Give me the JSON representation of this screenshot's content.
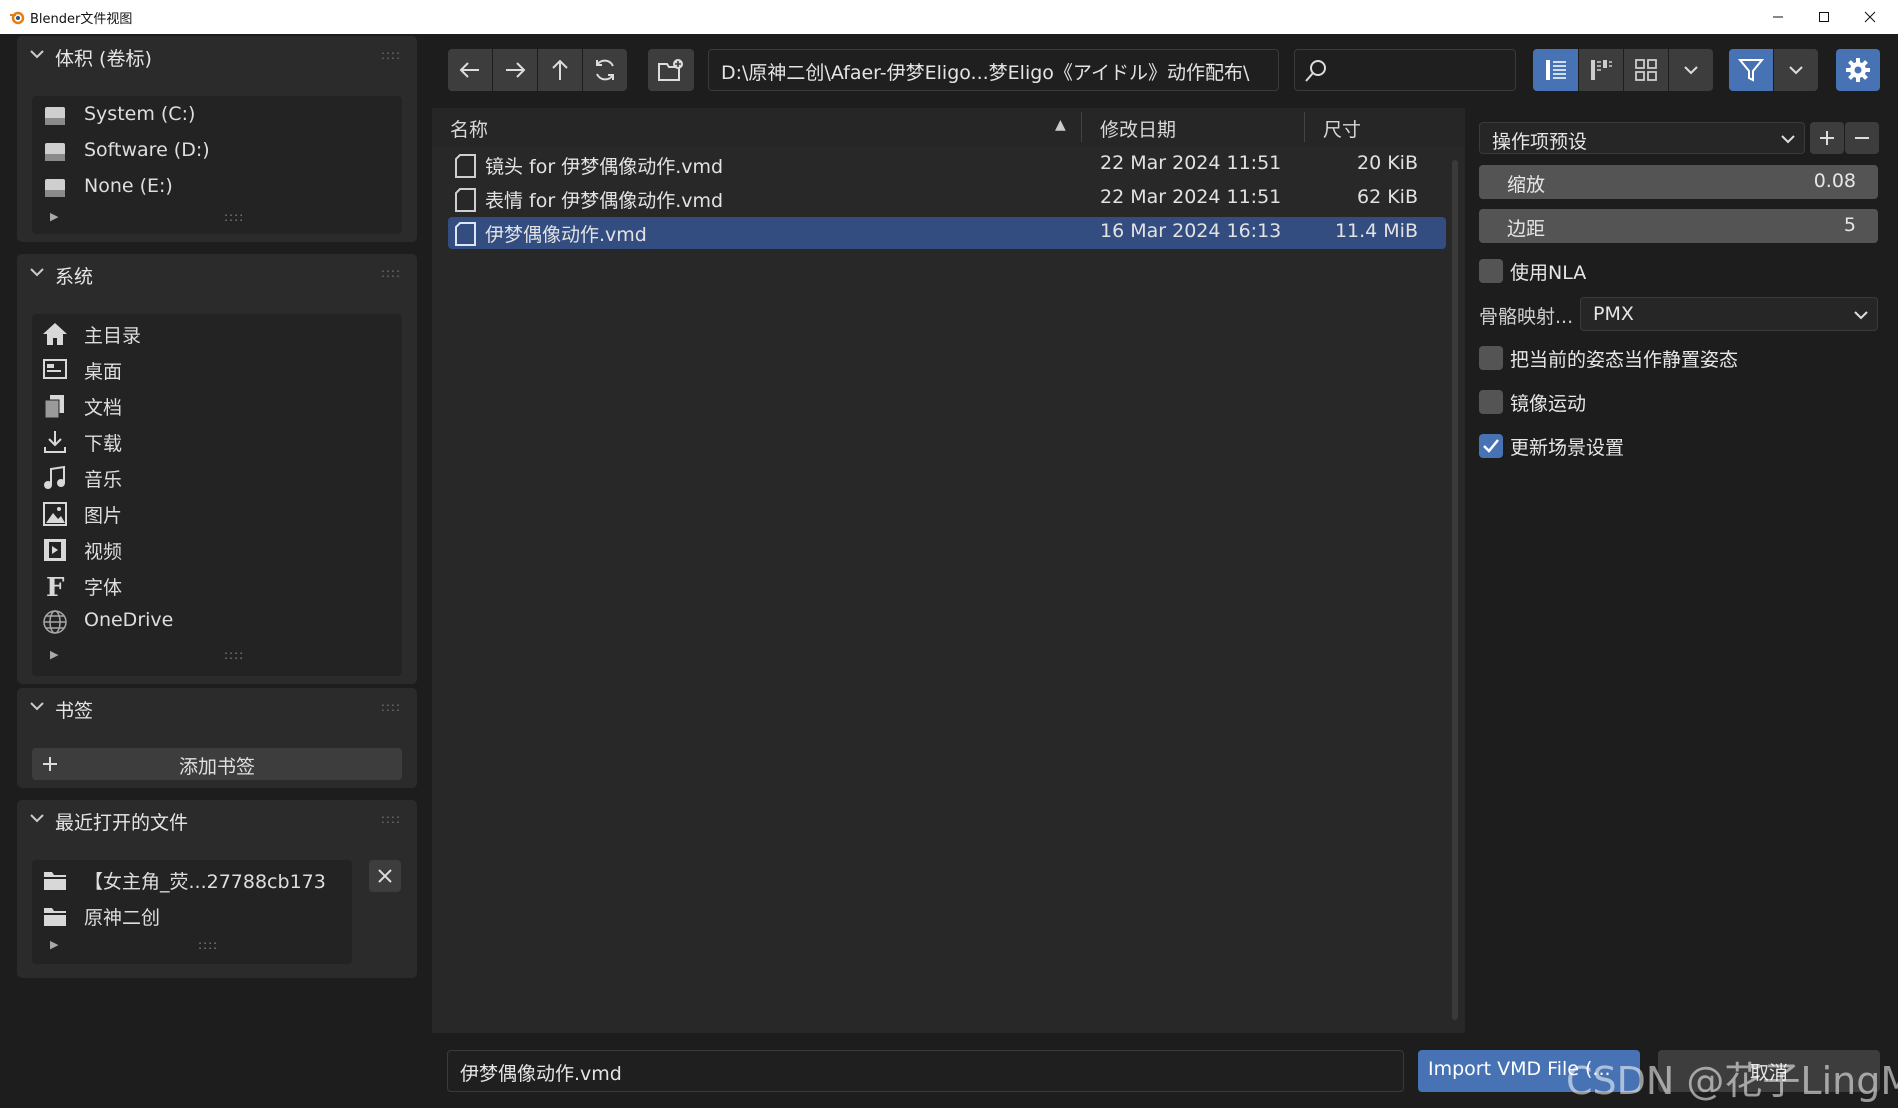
{
  "window": {
    "title": "Blender文件视图"
  },
  "sidebar": {
    "volumes": {
      "title": "体积 (卷标)",
      "items": [
        {
          "label": "System (C:)",
          "icon": "drive-icon"
        },
        {
          "label": "Software (D:)",
          "icon": "drive-icon"
        },
        {
          "label": "None (E:)",
          "icon": "drive-icon"
        }
      ]
    },
    "system": {
      "title": "系统",
      "items": [
        {
          "label": "主目录",
          "icon": "home-icon"
        },
        {
          "label": "桌面",
          "icon": "desktop-icon"
        },
        {
          "label": "文档",
          "icon": "documents-icon"
        },
        {
          "label": "下载",
          "icon": "download-icon"
        },
        {
          "label": "音乐",
          "icon": "music-icon"
        },
        {
          "label": "图片",
          "icon": "image-icon"
        },
        {
          "label": "视频",
          "icon": "video-icon"
        },
        {
          "label": "字体",
          "icon": "font-icon"
        },
        {
          "label": "OneDrive",
          "icon": "globe-icon"
        }
      ]
    },
    "bookmarks": {
      "title": "书签",
      "add_label": "添加书签"
    },
    "recent": {
      "title": "最近打开的文件",
      "items": [
        {
          "label": "【女主角_荧...27788cb173"
        },
        {
          "label": "原神二创"
        }
      ]
    }
  },
  "toolbar": {
    "path": "D:\\原神二创\\Afaer-伊梦Eligo...梦Eligo《アイドル》动作配布\\",
    "search_placeholder": ""
  },
  "filelist": {
    "columns": {
      "name": "名称",
      "date": "修改日期",
      "size": "尺寸"
    },
    "rows": [
      {
        "name": "镜头 for 伊梦偶像动作.vmd",
        "date": "22 Mar 2024 11:51",
        "size": "20 KiB",
        "selected": false
      },
      {
        "name": "表情 for 伊梦偶像动作.vmd",
        "date": "22 Mar 2024 11:51",
        "size": "62 KiB",
        "selected": false
      },
      {
        "name": "伊梦偶像动作.vmd",
        "date": "16 Mar 2024 16:13",
        "size": "11.4 MiB",
        "selected": true
      }
    ]
  },
  "options": {
    "preset_label": "操作项预设",
    "scale": {
      "label": "缩放",
      "value": "0.08"
    },
    "margin": {
      "label": "边距",
      "value": "5"
    },
    "use_nla": {
      "label": "使用NLA",
      "checked": false
    },
    "bone_mapper": {
      "label": "骨骼映射...",
      "value": "PMX"
    },
    "rest_pose": {
      "label": "把当前的姿态当作静置姿态",
      "checked": false
    },
    "mirror": {
      "label": "镜像运动",
      "checked": false
    },
    "update_scene": {
      "label": "更新场景设置",
      "checked": true
    }
  },
  "footer": {
    "filename": "伊梦偶像动作.vmd",
    "import_label": "Import VMD File (...",
    "cancel_label": "取消",
    "watermark": "CSDN @花子LingMo"
  },
  "colors": {
    "accent": "#4772b3",
    "selected_row": "#334d80"
  }
}
